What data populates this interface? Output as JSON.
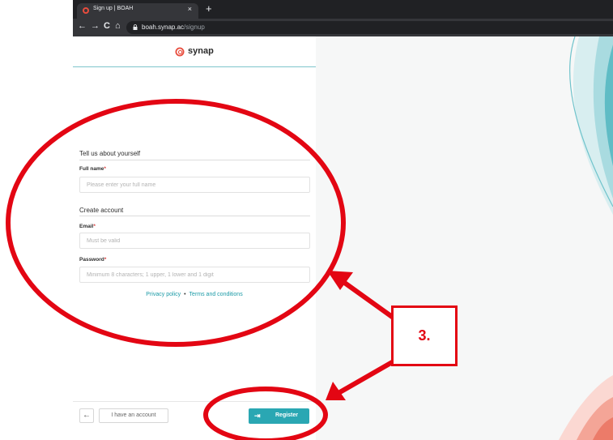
{
  "browser": {
    "tab_title": "Sign up | BOAH",
    "tab_close": "×",
    "new_tab": "+",
    "back": "←",
    "forward": "→",
    "reload": "C",
    "home": "⌂",
    "url_host": "boah.synap.ac",
    "url_path": "/signup"
  },
  "brand": {
    "name": "synap",
    "color": "#e84c3d"
  },
  "form": {
    "about_title": "Tell us about yourself",
    "full_name_label": "Full name",
    "full_name_placeholder": "Please enter your full name",
    "account_title": "Create account",
    "email_label": "Email",
    "email_placeholder": "Must be valid",
    "password_label": "Password",
    "password_placeholder": "Minimum 8 characters; 1 upper, 1 lower and 1 digit",
    "required_mark": "*",
    "privacy_link": "Privacy policy",
    "terms_link": "Terms and conditions",
    "link_separator": "•"
  },
  "footer": {
    "back_icon": "←",
    "have_account_label": "I have an account",
    "register_icon": "⇥",
    "register_label": "Register"
  },
  "annotation": {
    "step_label": "3.",
    "color": "#e30613"
  }
}
